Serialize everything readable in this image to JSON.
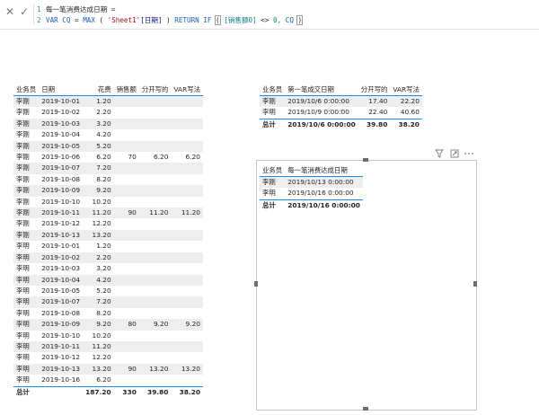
{
  "formula": {
    "line1_num": "1",
    "line1_text": "每一笔消费达成日期 =",
    "line2_num": "2",
    "line2_kw_var": "VAR",
    "line2_name": "CQ",
    "line2_eq": "=",
    "line2_max": "MAX",
    "line2_open": "(",
    "line2_table": "'Sheet1'",
    "line2_col": "[日期]",
    "line2_close": ")",
    "line2_return": "RETURN",
    "line2_if": "IF",
    "line2_if_open": "(",
    "line2_measure": "[销售额0]",
    "line2_op": "<>",
    "line2_zero": "0,",
    "line2_cq": "CQ",
    "line2_if_close": ")"
  },
  "table1": {
    "headers": [
      "业务员",
      "日期",
      "花费",
      "销售额",
      "分开写的",
      "VAR写法"
    ],
    "rows": [
      [
        "李刚",
        "2019-10-01",
        "1.20",
        "",
        "",
        ""
      ],
      [
        "李刚",
        "2019-10-02",
        "2.20",
        "",
        "",
        ""
      ],
      [
        "李刚",
        "2019-10-03",
        "3.20",
        "",
        "",
        ""
      ],
      [
        "李刚",
        "2019-10-04",
        "4.20",
        "",
        "",
        ""
      ],
      [
        "李刚",
        "2019-10-05",
        "5.20",
        "",
        "",
        ""
      ],
      [
        "李刚",
        "2019-10-06",
        "6.20",
        "70",
        "6.20",
        "6.20"
      ],
      [
        "李刚",
        "2019-10-07",
        "7.20",
        "",
        "",
        ""
      ],
      [
        "李刚",
        "2019-10-08",
        "8.20",
        "",
        "",
        ""
      ],
      [
        "李刚",
        "2019-10-09",
        "9.20",
        "",
        "",
        ""
      ],
      [
        "李刚",
        "2019-10-10",
        "10.20",
        "",
        "",
        ""
      ],
      [
        "李刚",
        "2019-10-11",
        "11.20",
        "90",
        "11.20",
        "11.20"
      ],
      [
        "李刚",
        "2019-10-12",
        "12.20",
        "",
        "",
        ""
      ],
      [
        "李刚",
        "2019-10-13",
        "13.20",
        "",
        "",
        ""
      ],
      [
        "李明",
        "2019-10-01",
        "1.20",
        "",
        "",
        ""
      ],
      [
        "李明",
        "2019-10-02",
        "2.20",
        "",
        "",
        ""
      ],
      [
        "李明",
        "2019-10-03",
        "3.20",
        "",
        "",
        ""
      ],
      [
        "李明",
        "2019-10-04",
        "4.20",
        "",
        "",
        ""
      ],
      [
        "李明",
        "2019-10-05",
        "5.20",
        "",
        "",
        ""
      ],
      [
        "李明",
        "2019-10-07",
        "7.20",
        "",
        "",
        ""
      ],
      [
        "李明",
        "2019-10-08",
        "8.20",
        "",
        "",
        ""
      ],
      [
        "李明",
        "2019-10-09",
        "9.20",
        "80",
        "9.20",
        "9.20"
      ],
      [
        "李明",
        "2019-10-10",
        "10.20",
        "",
        "",
        ""
      ],
      [
        "李明",
        "2019-10-11",
        "11.20",
        "",
        "",
        ""
      ],
      [
        "李明",
        "2019-10-12",
        "12.20",
        "",
        "",
        ""
      ],
      [
        "李明",
        "2019-10-13",
        "13.20",
        "90",
        "13.20",
        "13.20"
      ],
      [
        "李明",
        "2019-10-16",
        "6.20",
        "",
        "",
        ""
      ]
    ],
    "total": [
      "总计",
      "",
      "187.20",
      "330",
      "39.80",
      "38.20"
    ]
  },
  "table2": {
    "headers": [
      "业务员",
      "第一笔成交日期",
      "分开写的",
      "VAR写法"
    ],
    "rows": [
      [
        "李刚",
        "2019/10/6 0:00:00",
        "17.40",
        "22.20"
      ],
      [
        "李明",
        "2019/10/9 0:00:00",
        "22.40",
        "40.60"
      ]
    ],
    "total": [
      "总计",
      "2019/10/6 0:00:00",
      "39.80",
      "38.20"
    ]
  },
  "table3": {
    "headers": [
      "业务员",
      "每一笔消费达成日期"
    ],
    "rows": [
      [
        "李刚",
        "2019/10/13 0:00:00"
      ],
      [
        "李明",
        "2019/10/16 0:00:00"
      ]
    ],
    "total": [
      "总计",
      "2019/10/16 0:00:00"
    ]
  },
  "visual_header": {
    "filter_icon": "filter-icon",
    "focus_icon": "focus-mode-icon",
    "more_icon": "more-options-icon"
  }
}
